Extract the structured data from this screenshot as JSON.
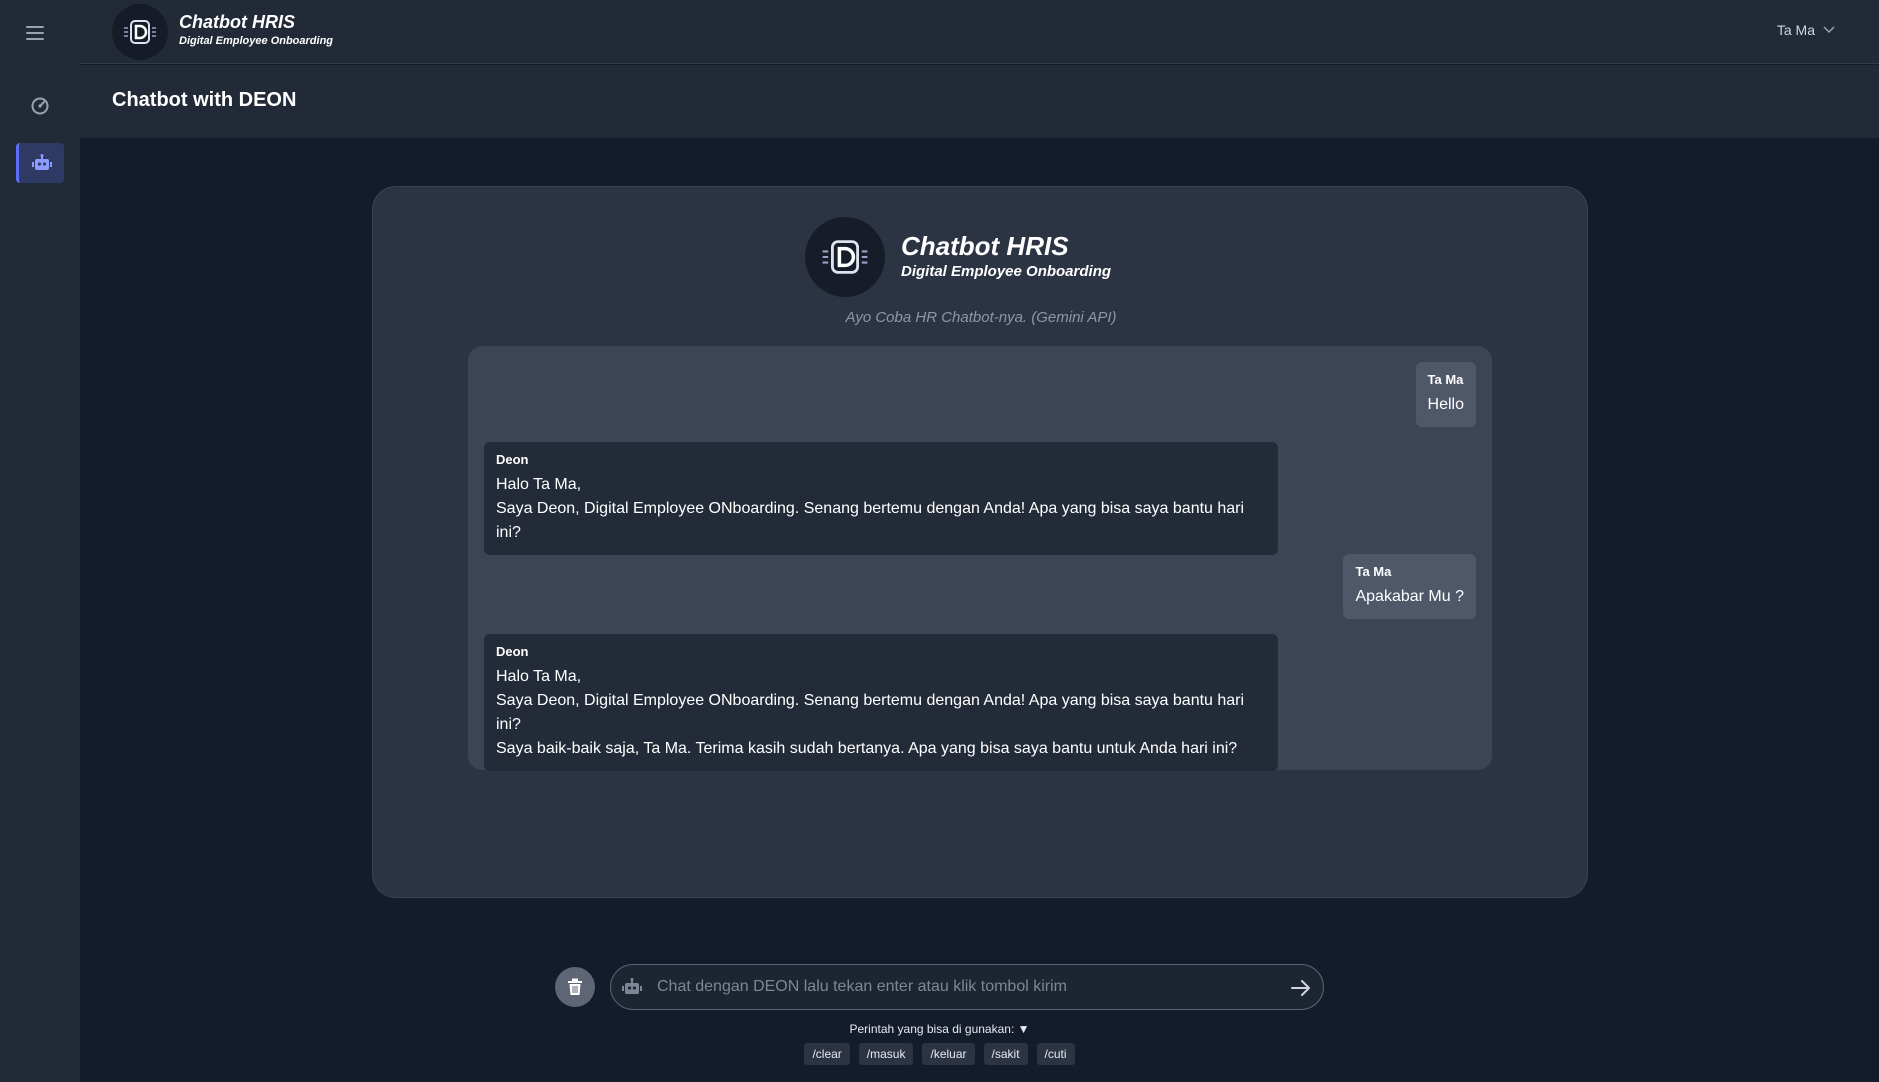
{
  "app": {
    "title": "Chatbot HRIS",
    "subtitle": "Digital Employee Onboarding",
    "logo_letter": "D"
  },
  "user": {
    "name": "Ta Ma"
  },
  "sidebar": {
    "items": [
      {
        "icon": "dashboard-icon",
        "active": false
      },
      {
        "icon": "robot-icon",
        "active": true
      }
    ]
  },
  "page": {
    "title": "Chatbot with DEON"
  },
  "card": {
    "title": "Chatbot HRIS",
    "subtitle": "Digital Employee Onboarding",
    "note": "Ayo Coba HR Chatbot-nya. (Gemini API)"
  },
  "messages": [
    {
      "role": "user",
      "sender": "Ta Ma",
      "text": "Hello"
    },
    {
      "role": "bot",
      "sender": "Deon",
      "text": "Halo Ta Ma,\nSaya Deon, Digital Employee ONboarding. Senang bertemu dengan Anda! Apa yang bisa saya bantu hari ini?"
    },
    {
      "role": "user",
      "sender": "Ta Ma",
      "text": "Apakabar Mu ?"
    },
    {
      "role": "bot",
      "sender": "Deon",
      "text": "Halo Ta Ma,\nSaya Deon, Digital Employee ONboarding. Senang bertemu dengan Anda! Apa yang bisa saya bantu hari ini?\nSaya baik-baik saja, Ta Ma. Terima kasih sudah bertanya. Apa yang bisa saya bantu untuk Anda hari ini?"
    }
  ],
  "composer": {
    "placeholder": "Chat dengan DEON lalu tekan enter atau klik tombol kirim",
    "value": ""
  },
  "commands": {
    "label": "Perintah yang bisa di gunakan: ▼",
    "items": [
      "/clear",
      "/masuk",
      "/keluar",
      "/sakit",
      "/cuti"
    ]
  },
  "colors": {
    "accent": "#5b6ef5",
    "background": "#141c2b",
    "panel": "#222a38"
  }
}
